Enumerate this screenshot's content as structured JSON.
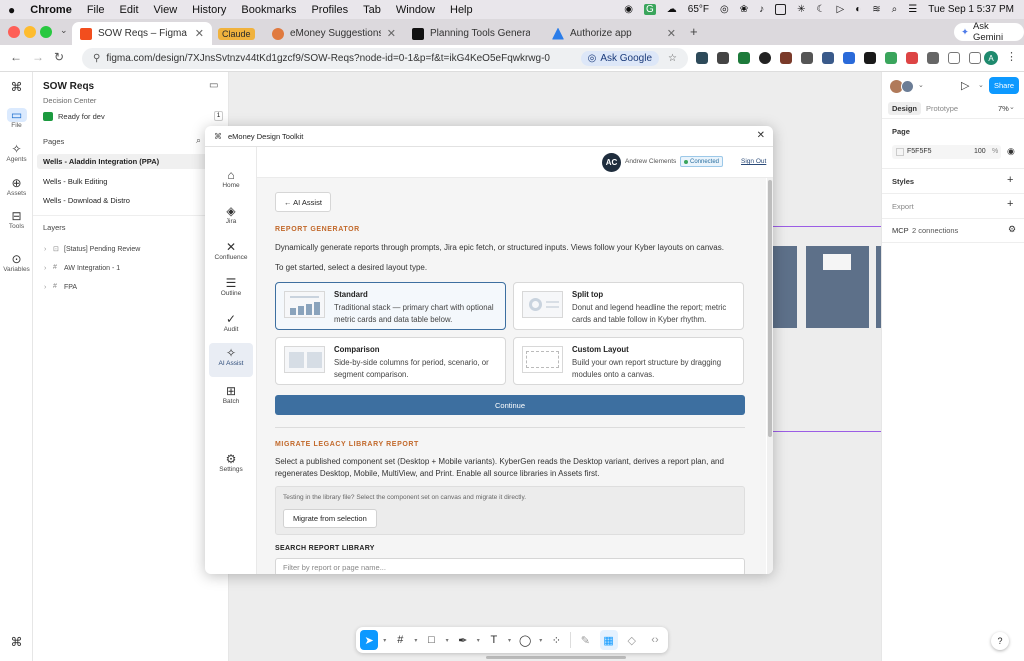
{
  "menubar": {
    "apple": "",
    "items": [
      "Chrome",
      "File",
      "Edit",
      "View",
      "History",
      "Bookmarks",
      "Profiles",
      "Tab",
      "Window",
      "Help"
    ],
    "weather": "65°F",
    "datetime": "Tue Sep 1  5:37 PM"
  },
  "tabs": [
    {
      "title": "SOW Reqs – Figma",
      "color": "#f24e1e"
    },
    {
      "title": "Claude",
      "color": "#d97757"
    },
    {
      "title": "eMoney Suggestions: Decisio",
      "color": "#e07a3f"
    },
    {
      "title": "Planning Tools General - Mai",
      "color": "#111111"
    },
    {
      "title": "Authorize app",
      "color": "#2b7de9"
    }
  ],
  "ask_gemini": "Ask Gemini",
  "address": {
    "url": "figma.com/design/7XJnsSvtnzv44tKd1gzcf9/SOW-Reqs?node-id=0-1&p=f&t=ikG4KeO5eFqwkrwg-0",
    "ask_google": "Ask Google",
    "profile_initial": "A"
  },
  "rail": {
    "file": "File",
    "agents": "Agents",
    "assets": "Assets",
    "tools": "Tools",
    "variables": "Variables"
  },
  "file_panel": {
    "file_name": "SOW Reqs",
    "project": "Decision Center",
    "status": "Ready for dev",
    "status_count": "1",
    "pages_header": "Pages",
    "pages": [
      "Wells - Aladdin Integration (PPA)",
      "Wells - Bulk Editing",
      "Wells - Download & Distro"
    ],
    "layers_header": "Layers",
    "layers": [
      "[Status] Pending Review",
      "AW Integration - 1",
      "FPA"
    ]
  },
  "right_panel": {
    "share": "Share",
    "tab_design": "Design",
    "tab_prototype": "Prototype",
    "zoom": "7%",
    "page_label": "Page",
    "page_color": "F5F5F5",
    "page_opacity": "100",
    "percent": "%",
    "styles": "Styles",
    "export": "Export",
    "mcp": "MCP",
    "mcp_connections": "2 connections"
  },
  "modal": {
    "title": "eMoney Design Toolkit",
    "nav": [
      "Home",
      "Jira",
      "Confluence",
      "Outline",
      "Audit",
      "AI Assist",
      "Batch",
      "Settings"
    ],
    "user_initials": "AC",
    "user_name": "Andrew Clements",
    "connected": "Connected",
    "sign_out": "Sign Out",
    "back": "← AI Assist",
    "report_header": "REPORT GENERATOR",
    "report_desc": "Dynamically generate reports through prompts, Jira epic fetch, or structured inputs. Views follow your Kyber layouts on canvas.",
    "select_prompt": "To get started, select a desired layout type.",
    "layouts": [
      {
        "title": "Standard",
        "desc": "Traditional stack — primary chart with optional metric cards and data table below."
      },
      {
        "title": "Split top",
        "desc": "Donut and legend headline the report; metric cards and table follow in Kyber rhythm."
      },
      {
        "title": "Comparison",
        "desc": "Side-by-side columns for period, scenario, or segment comparison."
      },
      {
        "title": "Custom Layout",
        "desc": "Build your own report structure by dragging modules onto a canvas."
      }
    ],
    "continue": "Continue",
    "migrate_header": "MIGRATE LEGACY LIBRARY REPORT",
    "migrate_desc_1": "Select a published component set (Desktop + Mobile variants). KyberGen reads the Desktop variant, derives a report plan, and",
    "migrate_desc_2": "regenerates Desktop, Mobile, MultiView, and Print. Enable all source libraries in Assets first.",
    "migrate_hint": "Testing in the library file? Select the component set on canvas and migrate it directly.",
    "migrate_button": "Migrate from selection",
    "search_header": "SEARCH REPORT LIBRARY",
    "search_placeholder": "Filter by report or page name..."
  }
}
